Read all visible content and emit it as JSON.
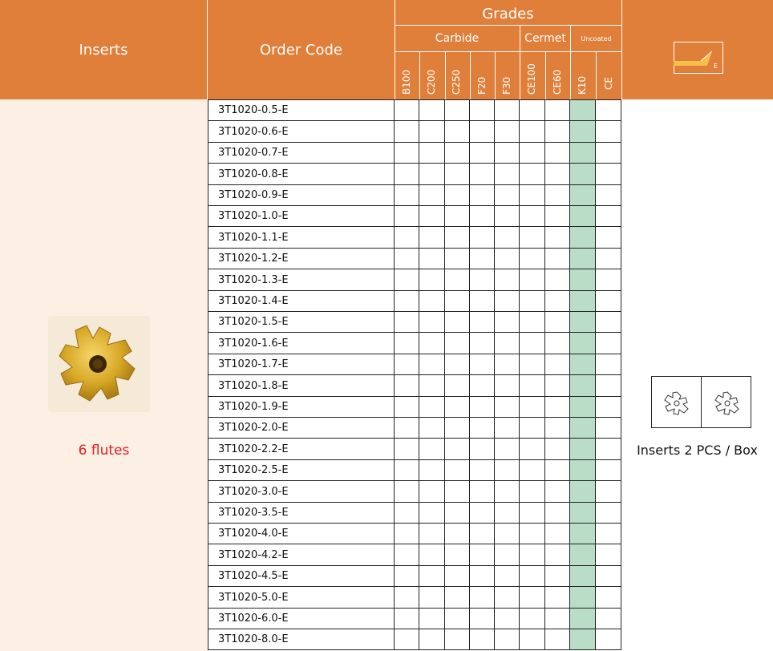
{
  "header": {
    "inserts": "Inserts",
    "order_code": "Order Code",
    "grades": "Grades",
    "carbide": "Carbide",
    "cermet": "Cermet",
    "uncoated": "Uncoated",
    "grade_codes": [
      "B100",
      "C200",
      "C250",
      "F20",
      "F30",
      "CE100",
      "CE60",
      "K10",
      "CE"
    ],
    "edge_letter": "E"
  },
  "product": {
    "flutes": "6 flutes",
    "box": "Inserts 2 PCS / Box",
    "image_icon": "gold-6-flute-insert"
  },
  "highlight_grade": "K10",
  "colors": {
    "header": "#e07f3a",
    "left_panel": "#fcefe3",
    "highlight": "#b9ddc6",
    "flutes_text": "#e01f1f"
  },
  "order_codes": [
    "3T1020-0.5-E",
    "3T1020-0.6-E",
    "3T1020-0.7-E",
    "3T1020-0.8-E",
    "3T1020-0.9-E",
    "3T1020-1.0-E",
    "3T1020-1.1-E",
    "3T1020-1.2-E",
    "3T1020-1.3-E",
    "3T1020-1.4-E",
    "3T1020-1.5-E",
    "3T1020-1.6-E",
    "3T1020-1.7-E",
    "3T1020-1.8-E",
    "3T1020-1.9-E",
    "3T1020-2.0-E",
    "3T1020-2.2-E",
    "3T1020-2.5-E",
    "3T1020-3.0-E",
    "3T1020-3.5-E",
    "3T1020-4.0-E",
    "3T1020-4.2-E",
    "3T1020-4.5-E",
    "3T1020-5.0-E",
    "3T1020-6.0-E",
    "3T1020-8.0-E"
  ]
}
